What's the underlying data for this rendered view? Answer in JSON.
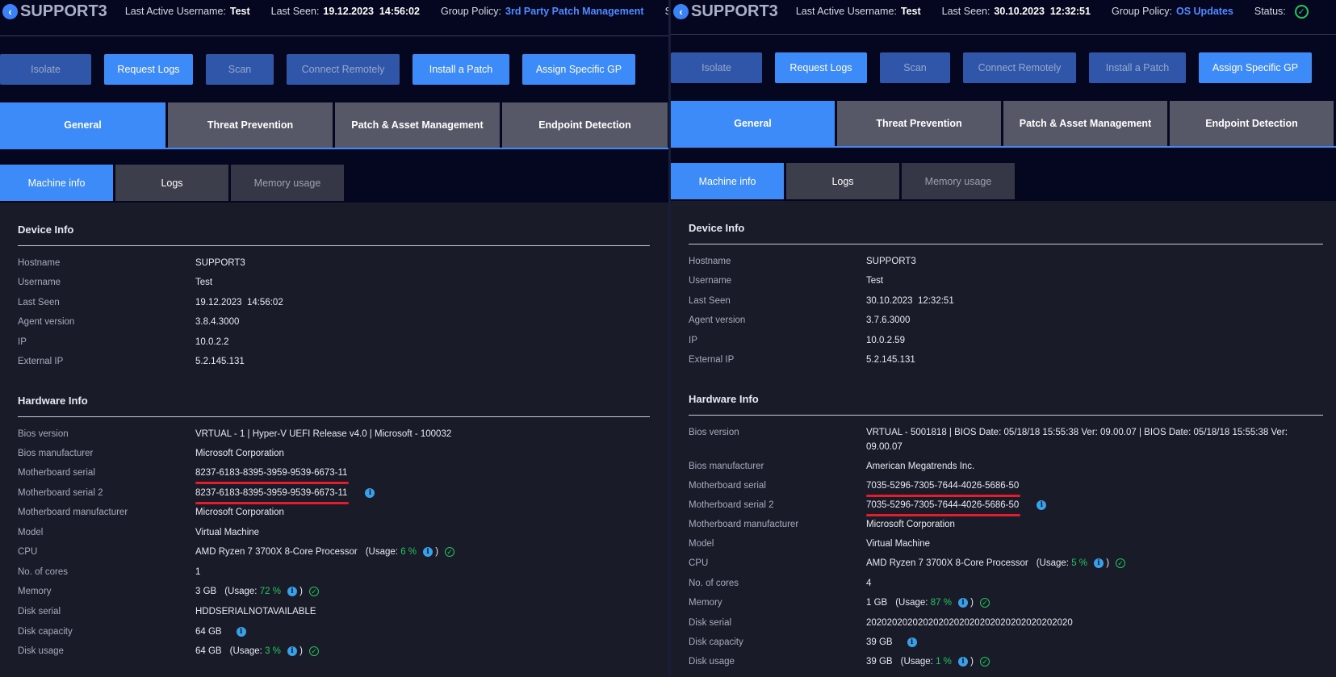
{
  "labels": {
    "last_active_username": "Last Active Username:",
    "last_seen": "Last Seen:",
    "group_policy": "Group Policy:",
    "status": "Status:",
    "usage_open": "(Usage:",
    "usage_close": ")",
    "info_glyph": "i",
    "ok_glyph": "✓",
    "back_glyph": "‹"
  },
  "buttons": [
    "Isolate",
    "Request Logs",
    "Scan",
    "Connect Remotely",
    "Install a Patch",
    "Assign Specific GP"
  ],
  "tabs": [
    "General",
    "Threat Prevention",
    "Patch & Asset Management",
    "Endpoint Detection"
  ],
  "subtabs": [
    "Machine info",
    "Logs",
    "Memory usage"
  ],
  "sections": {
    "device": "Device Info",
    "hardware": "Hardware Info"
  },
  "fields": {
    "hostname": "Hostname",
    "username": "Username",
    "last_seen": "Last Seen",
    "agent_version": "Agent version",
    "ip": "IP",
    "external_ip": "External IP",
    "bios_version": "Bios version",
    "bios_manufacturer": "Bios manufacturer",
    "mb_serial": "Motherboard serial",
    "mb_serial2": "Motherboard serial 2",
    "mb_manufacturer": "Motherboard manufacturer",
    "model": "Model",
    "cpu": "CPU",
    "cores": "No. of cores",
    "memory": "Memory",
    "disk_serial": "Disk serial",
    "disk_capacity": "Disk capacity",
    "disk_usage": "Disk usage"
  },
  "colors": {
    "accent": "#3d8bf8",
    "ok": "#22c55e",
    "highlight": "#e11d2e",
    "background": "#050620"
  },
  "panels": [
    {
      "hostname": "SUPPORT3",
      "last_active_username": "Test",
      "last_seen": "19.12.2023  14:56:02",
      "group_policy": "3rd Party Patch Management",
      "device": {
        "hostname": "SUPPORT3",
        "username": "Test",
        "last_seen": "19.12.2023  14:56:02",
        "agent_version": "3.8.4.3000",
        "ip": "10.0.2.2",
        "external_ip": "5.2.145.131"
      },
      "hardware": {
        "bios_version": "VRTUAL - 1 | Hyper-V UEFI Release v4.0 | Microsoft - 100032",
        "bios_manufacturer": "Microsoft Corporation",
        "mb_serial": "8237-6183-8395-3959-9539-6673-11",
        "mb_serial2": "8237-6183-8395-3959-9539-6673-11",
        "mb_manufacturer": "Microsoft Corporation",
        "model": "Virtual Machine",
        "cpu": "AMD Ryzen 7 3700X 8-Core Processor",
        "cpu_usage": "6 %",
        "cores": "1",
        "memory": "3 GB",
        "memory_usage": "72 %",
        "disk_serial": "HDDSERIALNOTAVAILABLE",
        "disk_capacity": "64 GB",
        "disk_usage": "64 GB",
        "disk_usage_pct": "3 %"
      }
    },
    {
      "hostname": "SUPPORT3",
      "last_active_username": "Test",
      "last_seen": "30.10.2023  12:32:51",
      "group_policy": "OS Updates",
      "device": {
        "hostname": "SUPPORT3",
        "username": "Test",
        "last_seen": "30.10.2023  12:32:51",
        "agent_version": "3.7.6.3000",
        "ip": "10.0.2.59",
        "external_ip": "5.2.145.131"
      },
      "hardware": {
        "bios_version": "VRTUAL - 5001818 | BIOS Date: 05/18/18 15:55:38 Ver: 09.00.07 | BIOS Date: 05/18/18 15:55:38 Ver: 09.00.07",
        "bios_manufacturer": "American Megatrends Inc.",
        "mb_serial": "7035-5296-7305-7644-4026-5686-50",
        "mb_serial2": "7035-5296-7305-7644-4026-5686-50",
        "mb_manufacturer": "Microsoft Corporation",
        "model": "Virtual Machine",
        "cpu": "AMD Ryzen 7 3700X 8-Core Processor",
        "cpu_usage": "5 %",
        "cores": "4",
        "memory": "1 GB",
        "memory_usage": "87 %",
        "disk_serial": "2020202020202020202020202020202020202020",
        "disk_capacity": "39 GB",
        "disk_usage": "39 GB",
        "disk_usage_pct": "1 %"
      }
    }
  ]
}
